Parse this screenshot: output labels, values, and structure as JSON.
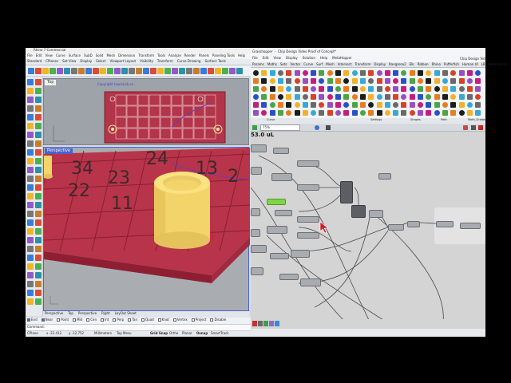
{
  "rhino": {
    "title": "Rhino 7 Commercial",
    "menu": [
      "File",
      "Edit",
      "View",
      "Curve",
      "Surface",
      "SubD",
      "Solid",
      "Mesh",
      "Dimension",
      "Transform",
      "Tools",
      "Analyze",
      "Render",
      "Panels",
      "Paneling Tools",
      "Help"
    ],
    "toolbar_tabs": [
      "Standard",
      "CPlanes",
      "Set View",
      "Display",
      "Select",
      "Viewport Layout",
      "Visibility",
      "Transform",
      "Curve Drawing",
      "Surface Tools"
    ],
    "viewport_top_label": "Top",
    "viewport_top_caption": "Copyright LewisLab.co",
    "viewport_persp_label": "Perspective",
    "chip_numbers_persp": [
      "34",
      "24",
      "13",
      "23",
      "2",
      "22",
      "11"
    ],
    "viewport_tabs": [
      "Perspective",
      "Top",
      "Perspective",
      "Right",
      "LayOut Sheet"
    ],
    "osnaps": [
      "End",
      "Near",
      "Point",
      "Mid",
      "Cen",
      "Int",
      "Perp",
      "Tan",
      "Quad",
      "Knot",
      "Vertex",
      "Project",
      "Disable"
    ],
    "command_label": "Command:",
    "status": {
      "cplane": "CPlane",
      "x": "x -22.412",
      "y": "y -12.752",
      "units": "Millimeters",
      "layer": "Top Mesu",
      "grid_snap": "Grid Snap",
      "ortho": "Ortho",
      "planar": "Planar",
      "osnap": "Osnap",
      "smarttrack": "SmartTrack"
    }
  },
  "grasshopper": {
    "app": "Grasshopper",
    "document_title": "Chip Design Video Proof of Concept*",
    "right_title": "Chip Design Vid",
    "menu": [
      "File",
      "Edit",
      "View",
      "Display",
      "Solution",
      "Help",
      "MetaHopper"
    ],
    "tabs": [
      "Params",
      "Maths",
      "Sets",
      "Vector",
      "Curve",
      "Surf",
      "Mesh",
      "Intersect",
      "Transform",
      "Display",
      "Kangaroo2",
      "Elk",
      "Ribbon",
      "Rhino",
      "Pufferfish",
      "Human UI",
      "LB",
      "Heteroptera",
      "Parakeet",
      "Weaverbird"
    ],
    "category_labels": [
      "Curve",
      "Settings",
      "Shapes",
      "Path",
      "Math_Graded"
    ],
    "zoom": "75%",
    "panel_value": "53.0 uL"
  }
}
